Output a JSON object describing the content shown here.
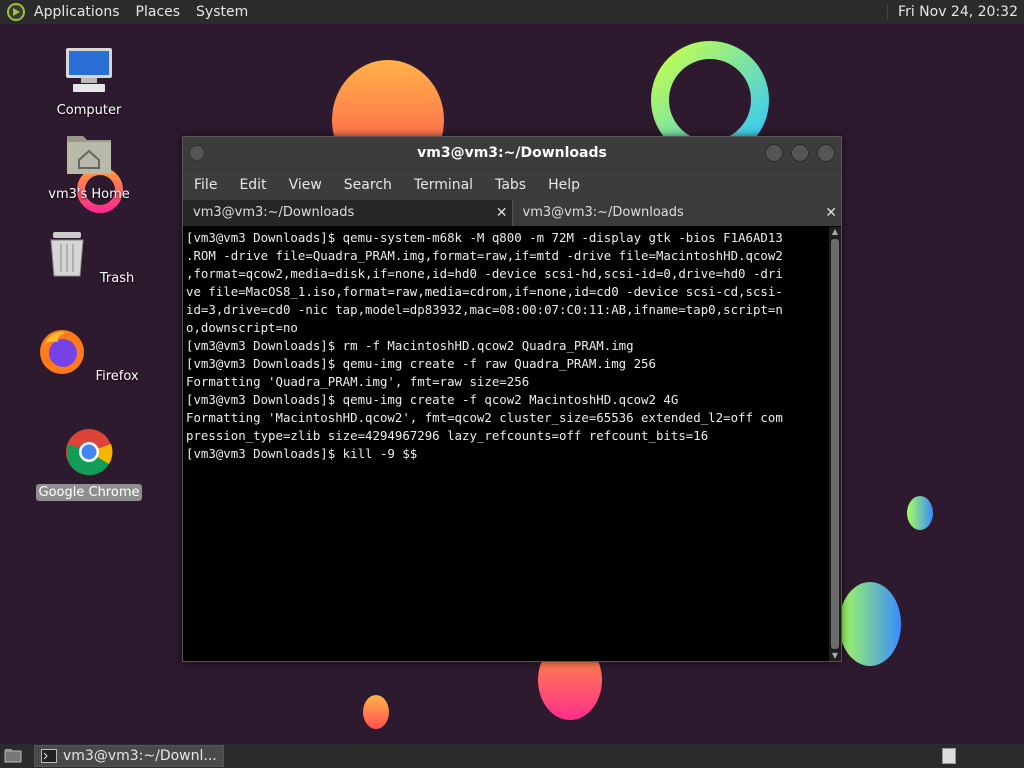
{
  "top_panel": {
    "menus": [
      "Applications",
      "Places",
      "System"
    ],
    "clock": "Fri Nov 24, 20:32"
  },
  "desktop_icons": [
    {
      "label": "Computer",
      "icon": "computer-icon"
    },
    {
      "label": "vm3's Home",
      "icon": "home-folder-icon"
    },
    {
      "label": "Trash",
      "icon": "trash-icon"
    },
    {
      "label": "Firefox",
      "icon": "firefox-icon"
    },
    {
      "label": "Google Chrome",
      "icon": "chrome-icon",
      "selected": true
    }
  ],
  "terminal": {
    "title": "vm3@vm3:~/Downloads",
    "menus": [
      "File",
      "Edit",
      "View",
      "Search",
      "Terminal",
      "Tabs",
      "Help"
    ],
    "tabs": [
      {
        "label": "vm3@vm3:~/Downloads",
        "active": false
      },
      {
        "label": "vm3@vm3:~/Downloads",
        "active": true
      }
    ],
    "lines": [
      "[vm3@vm3 Downloads]$ qemu-system-m68k -M q800 -m 72M -display gtk -bios F1A6AD13",
      ".ROM -drive file=Quadra_PRAM.img,format=raw,if=mtd -drive file=MacintoshHD.qcow2",
      ",format=qcow2,media=disk,if=none,id=hd0 -device scsi-hd,scsi-id=0,drive=hd0 -dri",
      "ve file=MacOS8_1.iso,format=raw,media=cdrom,if=none,id=cd0 -device scsi-cd,scsi-",
      "id=3,drive=cd0 -nic tap,model=dp83932,mac=08:00:07:C0:11:AB,ifname=tap0,script=n",
      "o,downscript=no",
      "[vm3@vm3 Downloads]$ rm -f MacintoshHD.qcow2 Quadra_PRAM.img",
      "[vm3@vm3 Downloads]$ qemu-img create -f raw Quadra_PRAM.img 256",
      "Formatting 'Quadra_PRAM.img', fmt=raw size=256",
      "[vm3@vm3 Downloads]$ qemu-img create -f qcow2 MacintoshHD.qcow2 4G",
      "Formatting 'MacintoshHD.qcow2', fmt=qcow2 cluster_size=65536 extended_l2=off com",
      "pression_type=zlib size=4294967296 lazy_refcounts=off refcount_bits=16",
      "[vm3@vm3 Downloads]$ kill -9 $$"
    ]
  },
  "bottom_panel": {
    "task_label": "vm3@vm3:~/Downl..."
  },
  "colors": {
    "wallpaper": "#2e1a2e",
    "panel": "#2b2b2b",
    "terminal_bg": "#000000",
    "terminal_fg": "#ececec"
  }
}
